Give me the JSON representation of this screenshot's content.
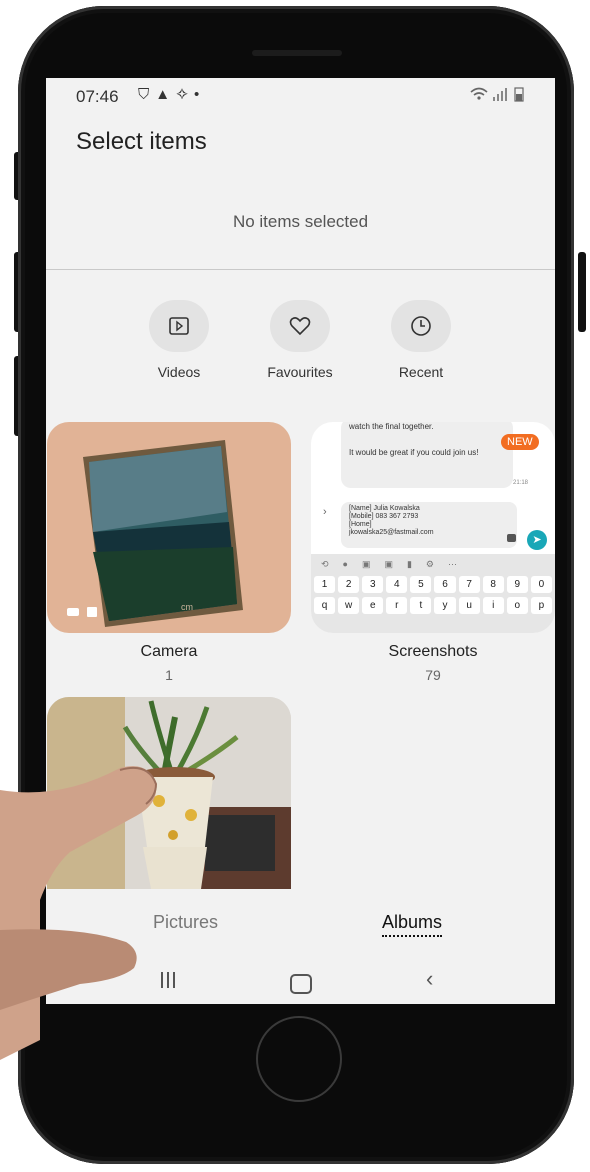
{
  "status_bar": {
    "time": "07:46",
    "icons": [
      "shield-icon",
      "warning-icon",
      "magic-wand-icon",
      "dot-icon"
    ]
  },
  "header": {
    "title": "Select items",
    "selection_status": "No items selected"
  },
  "quick_filters": [
    {
      "label": "Videos",
      "icon": "play-icon"
    },
    {
      "label": "Favourites",
      "icon": "heart-icon"
    },
    {
      "label": "Recent",
      "icon": "clock-icon"
    }
  ],
  "albums": [
    {
      "name": "Camera",
      "count": "1"
    },
    {
      "name": "Screenshots",
      "count": "79"
    },
    {
      "name": "",
      "count": ""
    }
  ],
  "screenshot_thumb": {
    "msg_top": "watch the final together.",
    "msg_main": "It would be great if you could join us!",
    "badge": "NEW",
    "msg_time": "21:18",
    "draft_lines": [
      "[Name] Julia Kowalska",
      "[Mobile] 083 367 2793",
      "[Home]",
      "jkowalska25@fastmail.com"
    ],
    "number_row": [
      "1",
      "2",
      "3",
      "4",
      "5",
      "6",
      "7",
      "8",
      "9",
      "0"
    ],
    "letter_row": [
      "q",
      "w",
      "e",
      "r",
      "t",
      "y",
      "u",
      "i",
      "o",
      "p"
    ],
    "camera_watermark": "cm"
  },
  "bottom_tabs": {
    "pictures": "Pictures",
    "albums": "Albums",
    "active": "Albums"
  },
  "nav_bar": {
    "recents": "recents-icon",
    "home": "home-icon",
    "back": "back-icon"
  }
}
